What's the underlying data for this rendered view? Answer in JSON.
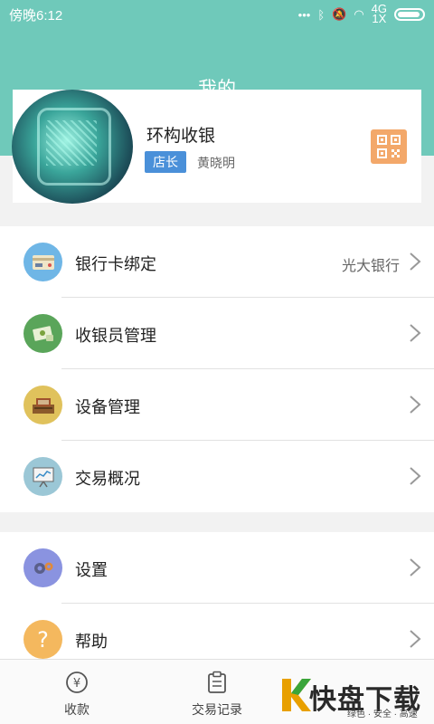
{
  "status_bar": {
    "time": "傍晚6:12",
    "icons": [
      "dots-icon",
      "bluetooth-icon",
      "mute-icon",
      "wifi-icon",
      "signal-icon",
      "battery-icon"
    ],
    "network_label_top": "4G",
    "network_label_bottom": "1X"
  },
  "header": {
    "title": "我的"
  },
  "profile": {
    "store_name": "环构收银",
    "role": "店长",
    "owner_name": "黄晓明"
  },
  "menu_groups": [
    {
      "items": [
        {
          "label": "银行卡绑定",
          "value": "光大银行",
          "icon": "bank-card-icon",
          "icon_bg": "#6fb6e6"
        },
        {
          "label": "收银员管理",
          "value": "",
          "icon": "cashier-icon",
          "icon_bg": "#5aa55a"
        },
        {
          "label": "设备管理",
          "value": "",
          "icon": "device-icon",
          "icon_bg": "#e0c25c"
        },
        {
          "label": "交易概况",
          "value": "",
          "icon": "chart-board-icon",
          "icon_bg": "#9bc7d6"
        }
      ]
    },
    {
      "items": [
        {
          "label": "设置",
          "value": "",
          "icon": "gears-icon",
          "icon_bg": "#8a93e0"
        },
        {
          "label": "帮助",
          "value": "",
          "icon": "help-icon",
          "icon_bg": "#f4b85e"
        }
      ]
    }
  ],
  "bottom_nav": [
    {
      "label": "收款",
      "icon": "yen-coin-icon"
    },
    {
      "label": "交易记录",
      "icon": "clipboard-icon"
    }
  ],
  "watermark": {
    "text": "快盘下载",
    "sub": "绿色 · 安全 · 高速"
  },
  "colors": {
    "theme": "#6fc9ba",
    "role_badge": "#4a90d9",
    "qr_button": "#f3a86a"
  }
}
